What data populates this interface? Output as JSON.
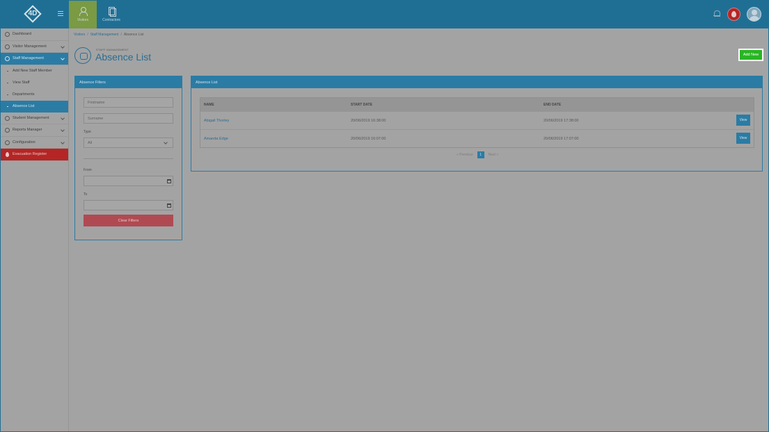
{
  "topbar": {
    "logo_text": "4D",
    "tabs": [
      {
        "label": "Visitors",
        "icon": "visitor-icon",
        "active": true
      },
      {
        "label": "Contractors",
        "icon": "clipboard-icon",
        "active": false
      }
    ]
  },
  "sidebar": {
    "items": [
      {
        "label": "Dashboard"
      },
      {
        "label": "Visitor Management"
      },
      {
        "label": "Staff Management"
      },
      {
        "label": "Add New Staff Member"
      },
      {
        "label": "View Staff"
      },
      {
        "label": "Departments"
      },
      {
        "label": "Absence List"
      },
      {
        "label": "Student Management"
      },
      {
        "label": "Reports Manager"
      },
      {
        "label": "Configuration"
      },
      {
        "label": "Evacuation Register"
      }
    ]
  },
  "breadcrumb": {
    "visitors": "Visitors",
    "staff": "Staff Management",
    "current": "Absence List",
    "separator": "/"
  },
  "page": {
    "kicker": "STAFF MANAGEMENT",
    "title": "Absence List",
    "add_new": "Add New"
  },
  "filters": {
    "title": "Absence Filters",
    "firstname_placeholder": "Firstname",
    "surname_placeholder": "Surname",
    "type_label": "Type",
    "type_value": "All",
    "from_label": "From",
    "to_label": "To",
    "clear_label": "Clear Filters"
  },
  "list": {
    "title": "Absence List",
    "columns": [
      "NAME",
      "START DATE",
      "END DATE"
    ],
    "rows": [
      {
        "name": "Abigail Thorley",
        "start": "20/06/2019 16:38:00",
        "end": "20/06/2019 17:38:00",
        "action": "View"
      },
      {
        "name": "Amanda Edge",
        "start": "20/06/2019 16:07:00",
        "end": "20/06/2019 17:07:00",
        "action": "View"
      }
    ],
    "pager": {
      "prev": "« Previous",
      "page": "1",
      "next": "Next »"
    }
  },
  "colors": {
    "brand": "#1f6f95",
    "accent": "#2a7ca5",
    "add": "#28b623",
    "danger": "#b52525"
  }
}
